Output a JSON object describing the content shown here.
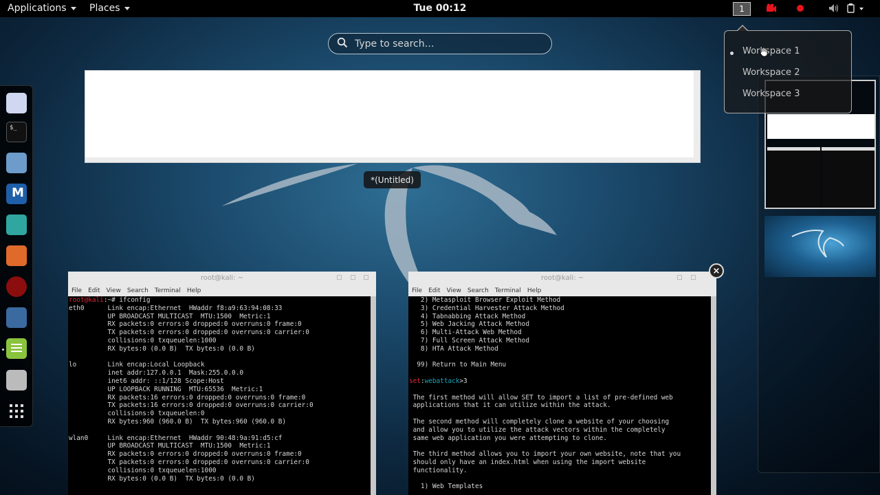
{
  "topbar": {
    "applications": "Applications",
    "places": "Places",
    "clock": "Tue 00:12",
    "workspace_number": "1"
  },
  "search": {
    "placeholder": "Type to search…"
  },
  "window_label": "*(Untitled)",
  "popup": {
    "items": [
      "Workspace 1",
      "Workspace 2",
      "Workspace 3"
    ],
    "active_index": 0
  },
  "terminal_left": {
    "title": "root@kali: ~",
    "menu": [
      "File",
      "Edit",
      "View",
      "Search",
      "Terminal",
      "Help"
    ],
    "prompt_user": "root@kali",
    "prompt_rest": ":~# ifconfig",
    "output": "eth0      Link encap:Ethernet  HWaddr f8:a9:63:94:08:33\n          UP BROADCAST MULTICAST  MTU:1500  Metric:1\n          RX packets:0 errors:0 dropped:0 overruns:0 frame:0\n          TX packets:0 errors:0 dropped:0 overruns:0 carrier:0\n          collisions:0 txqueuelen:1000\n          RX bytes:0 (0.0 B)  TX bytes:0 (0.0 B)\n\nlo        Link encap:Local Loopback\n          inet addr:127.0.0.1  Mask:255.0.0.0\n          inet6 addr: ::1/128 Scope:Host\n          UP LOOPBACK RUNNING  MTU:65536  Metric:1\n          RX packets:16 errors:0 dropped:0 overruns:0 frame:0\n          TX packets:16 errors:0 dropped:0 overruns:0 carrier:0\n          collisions:0 txqueuelen:0\n          RX bytes:960 (960.0 B)  TX bytes:960 (960.0 B)\n\nwlan0     Link encap:Ethernet  HWaddr 90:48:9a:91:d5:cf\n          UP BROADCAST MULTICAST  MTU:1500  Metric:1\n          RX packets:0 errors:0 dropped:0 overruns:0 frame:0\n          TX packets:0 errors:0 dropped:0 overruns:0 carrier:0\n          collisions:0 txqueuelen:1000\n          RX bytes:0 (0.0 B)  TX bytes:0 (0.0 B)"
  },
  "terminal_right": {
    "title": "root@kali: ~",
    "menu": [
      "File",
      "Edit",
      "View",
      "Search",
      "Terminal",
      "Help"
    ],
    "menu_top": "   2) Metasploit Browser Exploit Method\n   3) Credential Harvester Attack Method\n   4) Tabnabbing Attack Method\n   5) Web Jacking Attack Method\n   6) Multi-Attack Web Method\n   7) Full Screen Attack Method\n   8) HTA Attack Method\n\n  99) Return to Main Menu\n",
    "prompt_set": "set",
    "prompt_colon": ":",
    "prompt_module": "webattack",
    "prompt_rest": ">3",
    "description": "\n The first method will allow SET to import a list of pre-defined web\n applications that it can utilize within the attack.\n\n The second method will completely clone a website of your choosing\n and allow you to utilize the attack vectors within the completely\n same web application you were attempting to clone.\n\n The third method allows you to import your own website, note that you\n should only have an index.html when using the import website\n functionality.\n\n   1) Web Templates"
  },
  "colors": {
    "prompt_red": "#e0283a",
    "prompt_cyan": "#1ba5bc",
    "topbar_bg": "#000000",
    "record_red": "#e8141e"
  },
  "icons": [
    "app-menu-caret-icon",
    "places-caret-icon",
    "record-icon",
    "video-camera-icon",
    "volume-icon",
    "power-icon",
    "search-icon",
    "close-icon",
    "show-apps-grid-icon"
  ]
}
